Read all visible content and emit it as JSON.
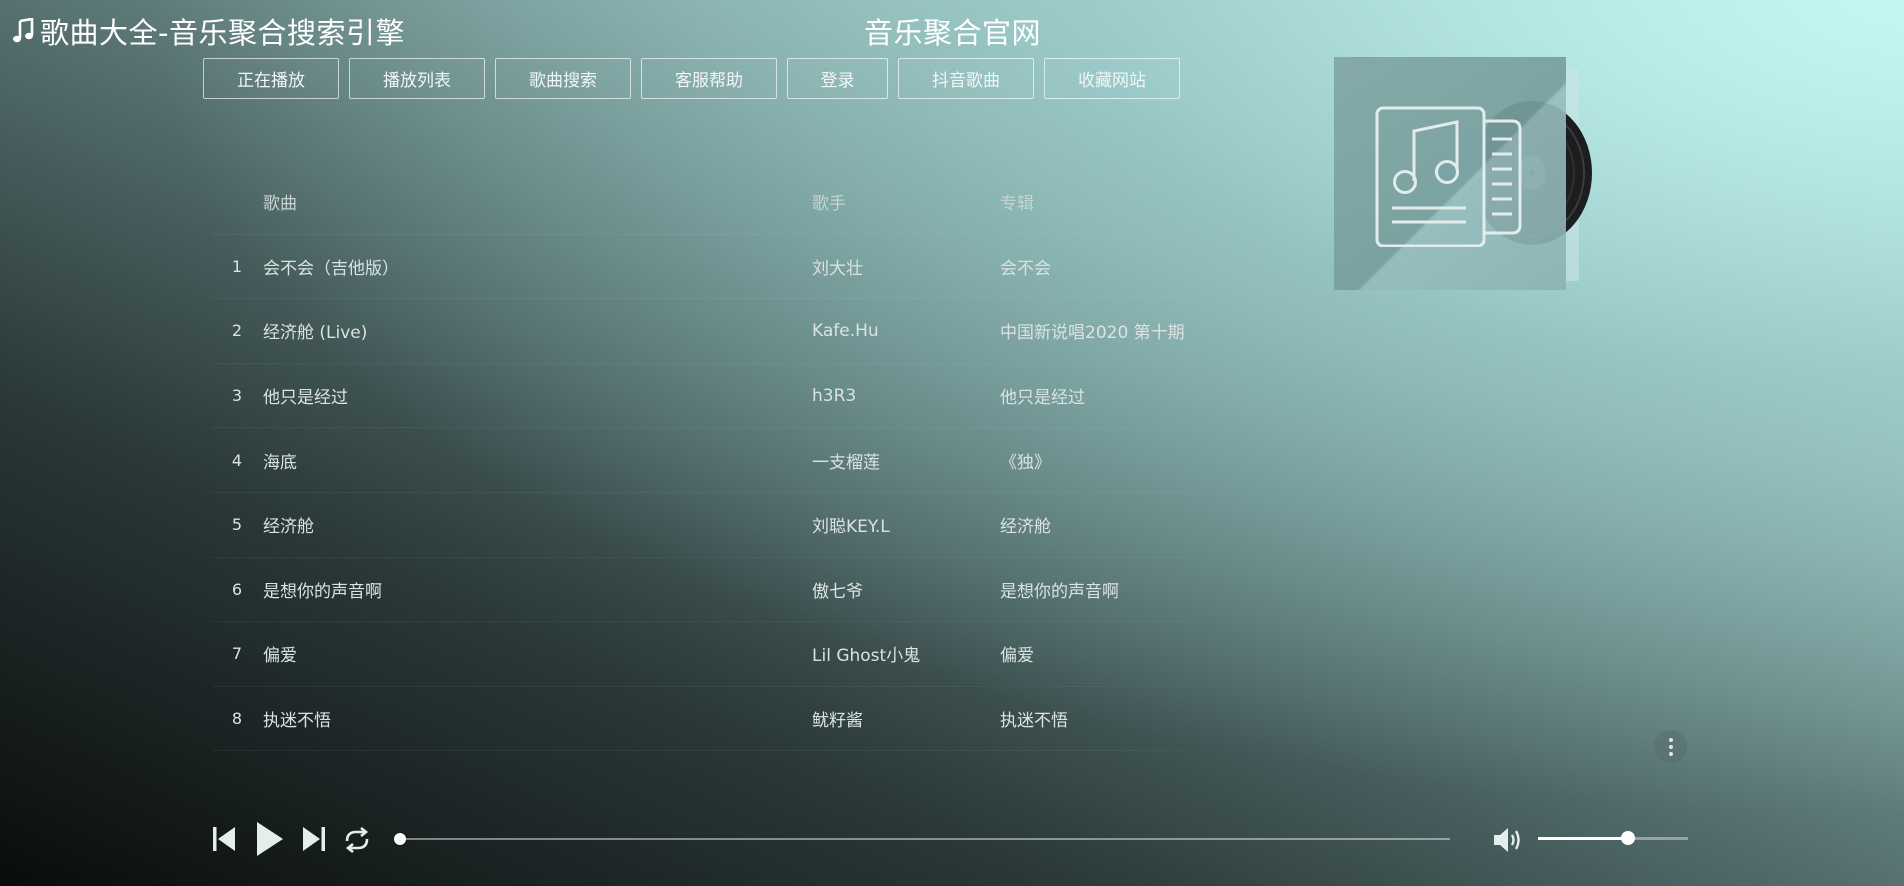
{
  "header": {
    "site_title": "歌曲大全-音乐聚合搜索引擎",
    "center_title": "音乐聚合官网"
  },
  "nav": [
    {
      "label": "正在播放",
      "name": "nav-now-playing"
    },
    {
      "label": "播放列表",
      "name": "nav-playlist"
    },
    {
      "label": "歌曲搜索",
      "name": "nav-song-search"
    },
    {
      "label": "客服帮助",
      "name": "nav-help"
    },
    {
      "label": "登录",
      "name": "nav-login"
    },
    {
      "label": "抖音歌曲",
      "name": "nav-douyin-songs"
    },
    {
      "label": "收藏网站",
      "name": "nav-bookmark"
    }
  ],
  "list": {
    "headers": {
      "song": "歌曲",
      "artist": "歌手",
      "album": "专辑"
    },
    "rows": [
      {
        "num": "1",
        "song": "会不会（吉他版）",
        "artist": "刘大壮",
        "album": "会不会"
      },
      {
        "num": "2",
        "song": "经济舱 (Live)",
        "artist": "Kafe.Hu",
        "album": "中国新说唱2020 第十期"
      },
      {
        "num": "3",
        "song": "他只是经过",
        "artist": "h3R3",
        "album": "他只是经过"
      },
      {
        "num": "4",
        "song": "海底",
        "artist": "一支榴莲",
        "album": "《独》"
      },
      {
        "num": "5",
        "song": "经济舱",
        "artist": "刘聪KEY.L",
        "album": "经济舱"
      },
      {
        "num": "6",
        "song": "是想你的声音啊",
        "artist": "傲七爷",
        "album": "是想你的声音啊"
      },
      {
        "num": "7",
        "song": "偏爱",
        "artist": "Lil Ghost小鬼",
        "album": "偏爱"
      },
      {
        "num": "8",
        "song": "执迷不悟",
        "artist": "鱿籽酱",
        "album": "执迷不悟"
      }
    ]
  },
  "player": {
    "progress": 0,
    "volume": 0.6
  },
  "icons": {
    "title": "music-note-icon",
    "prev": "skip-previous-icon",
    "play": "play-icon",
    "next": "skip-next-icon",
    "loop": "loop-icon",
    "volume": "volume-icon",
    "more": "more-vertical-icon",
    "cover": "album-cover-icon"
  }
}
